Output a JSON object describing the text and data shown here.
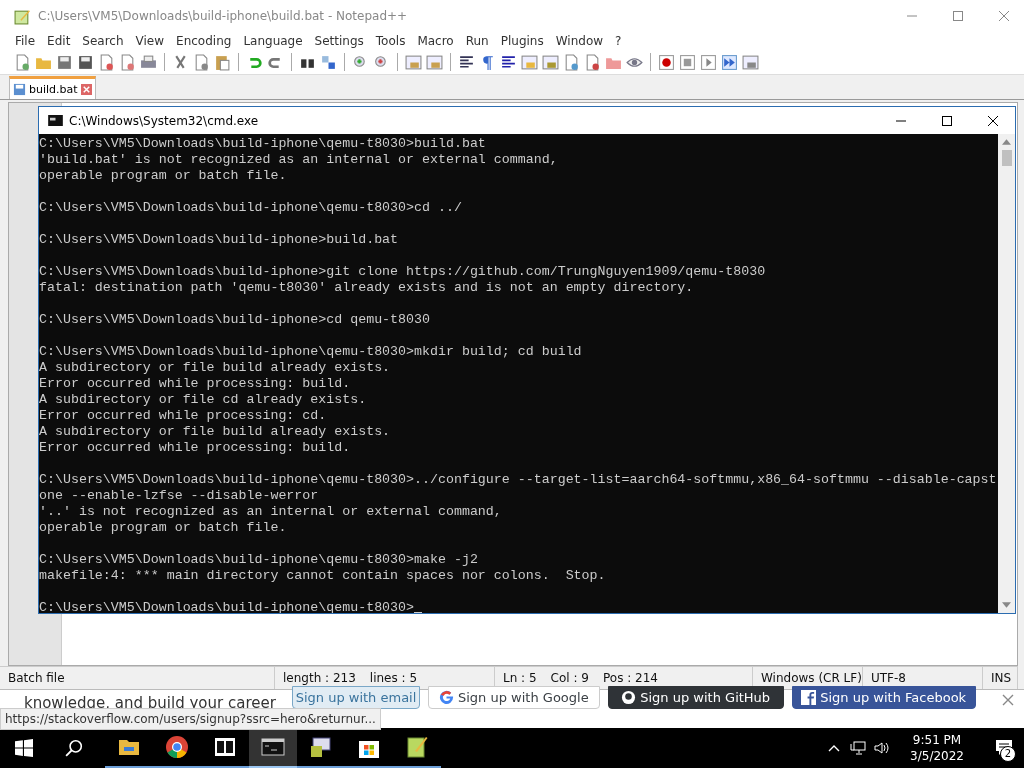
{
  "notepad": {
    "title": "C:\\Users\\VM5\\Downloads\\build-iphone\\build.bat - Notepad++",
    "menu": [
      "File",
      "Edit",
      "Search",
      "View",
      "Encoding",
      "Language",
      "Settings",
      "Tools",
      "Macro",
      "Run",
      "Plugins",
      "Window",
      "?"
    ],
    "tabs": [
      {
        "label": "build.bat",
        "selected": true
      }
    ],
    "status_bar": [
      {
        "texts": [
          "Batch file"
        ]
      },
      {
        "texts": [
          "length : 213",
          "lines : 5"
        ]
      },
      {
        "texts": [
          "Ln : 5",
          "Col : 9",
          "Pos : 214"
        ]
      },
      {
        "texts": [
          "Windows (CR LF)"
        ]
      },
      {
        "texts": [
          "UTF-8"
        ]
      },
      {
        "texts": [
          "INS"
        ]
      }
    ]
  },
  "cmd": {
    "title": "C:\\Windows\\System32\\cmd.exe",
    "blocks": [
      [
        "C:\\Users\\VM5\\Downloads\\build-iphone\\qemu-t8030>build.bat",
        "'build.bat' is not recognized as an internal or external command,",
        "operable program or batch file."
      ],
      [
        "C:\\Users\\VM5\\Downloads\\build-iphone\\qemu-t8030>cd ../"
      ],
      [
        "C:\\Users\\VM5\\Downloads\\build-iphone>build.bat"
      ],
      [
        "C:\\Users\\VM5\\Downloads\\build-iphone>git clone https://github.com/TrungNguyen1909/qemu-t8030",
        "fatal: destination path 'qemu-t8030' already exists and is not an empty directory."
      ],
      [
        "C:\\Users\\VM5\\Downloads\\build-iphone>cd qemu-t8030"
      ],
      [
        "C:\\Users\\VM5\\Downloads\\build-iphone\\qemu-t8030>mkdir build; cd build",
        "A subdirectory or file build already exists.",
        "Error occurred while processing: build.",
        "A subdirectory or file cd already exists.",
        "Error occurred while processing: cd.",
        "A subdirectory or file build already exists.",
        "Error occurred while processing: build."
      ],
      [
        "C:\\Users\\VM5\\Downloads\\build-iphone\\qemu-t8030>../configure --target-list=aarch64-softmmu,x86_64-softmmu --disable-capst",
        "one --enable-lzfse --disable-werror",
        "'..' is not recognized as an internal or external command,",
        "operable program or batch file."
      ],
      [
        "C:\\Users\\VM5\\Downloads\\build-iphone\\qemu-t8030>make -j2",
        "makefile:4: *** main directory cannot contain spaces nor colons.  Stop."
      ],
      [
        "C:\\Users\\VM5\\Downloads\\build-iphone\\qemu-t8030>"
      ]
    ]
  },
  "browser": {
    "tagline": "knowledge, and build your career",
    "buttons": [
      {
        "kind": "email",
        "label": "Sign up with email"
      },
      {
        "kind": "google",
        "label": "Sign up with Google"
      },
      {
        "kind": "github",
        "label": "Sign up with GitHub"
      },
      {
        "kind": "facebook",
        "label": "Sign up with Facebook"
      }
    ],
    "link_preview": "https://stackoverflow.com/users/signup?ssrc=hero&returnur..."
  },
  "taskbar": {
    "apps": [
      {
        "kind": "folder",
        "selected": false
      },
      {
        "kind": "chrome",
        "selected": false
      },
      {
        "kind": "archive",
        "selected": false
      },
      {
        "kind": "terminal",
        "selected": true
      },
      {
        "kind": "installer",
        "selected": false
      },
      {
        "kind": "store",
        "selected": false
      },
      {
        "kind": "editor",
        "selected": false
      }
    ],
    "time": "9:51 PM",
    "date": "3/5/2022",
    "notification_count": "2"
  }
}
